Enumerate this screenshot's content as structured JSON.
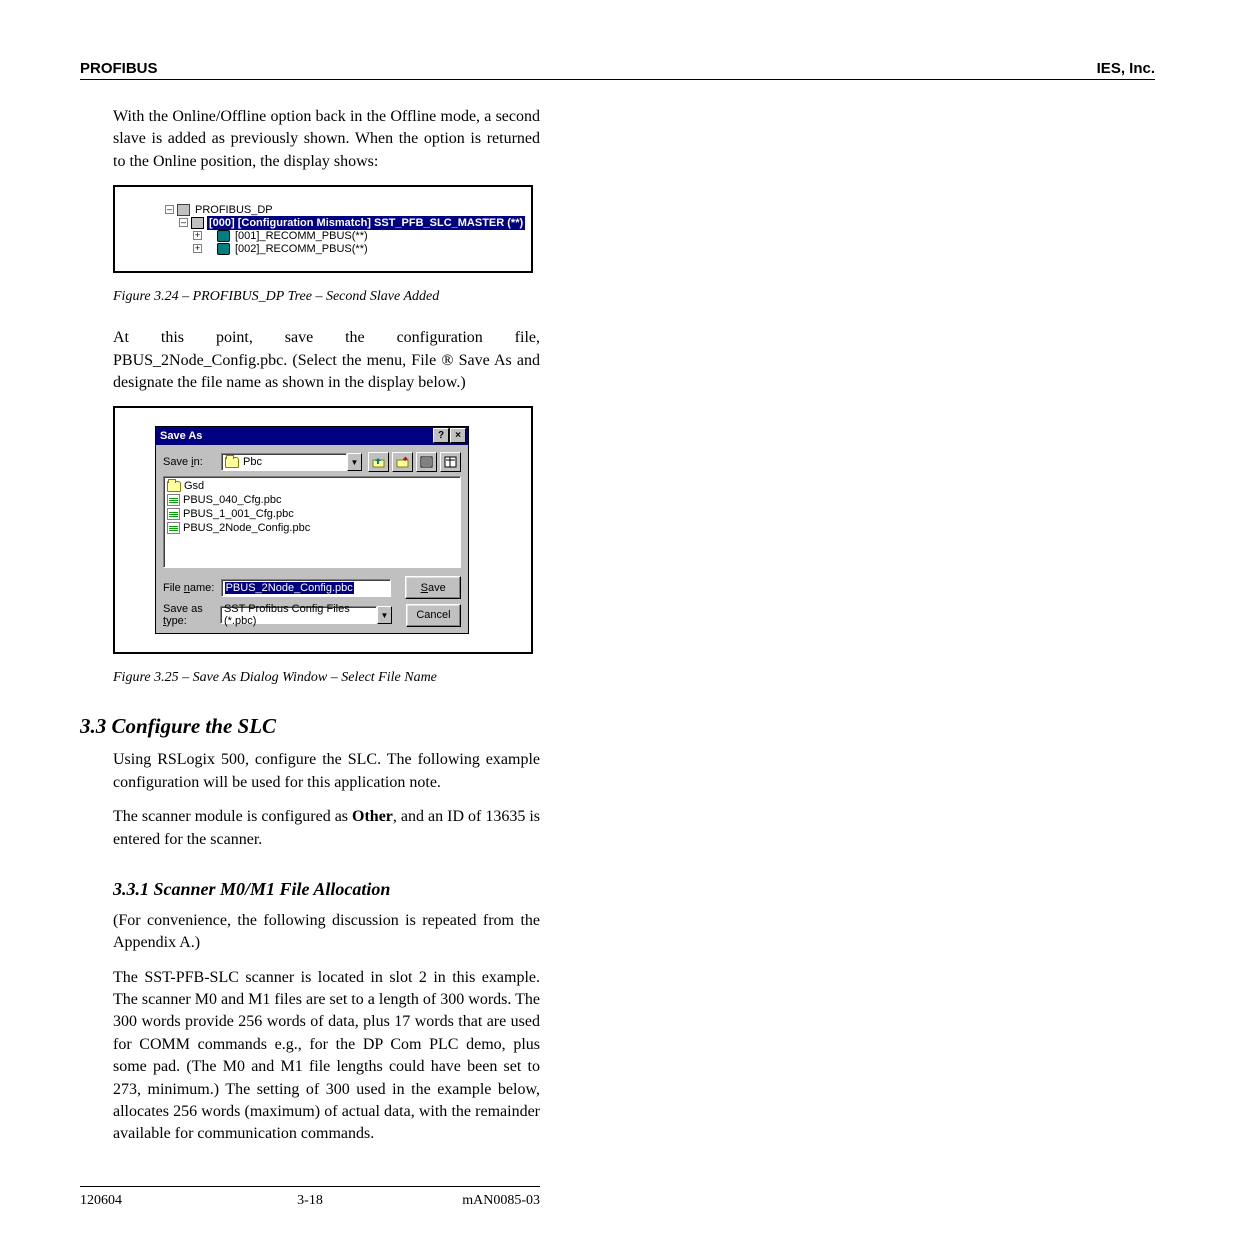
{
  "header": {
    "doc_left": "PROFIBUS",
    "doc_right": "IES, Inc."
  },
  "para1": "With the Online/Offline option back in the Offline mode, a second slave is added as previously shown. When the option is returned to the Online position, the display shows:",
  "tree": {
    "root_label": "PROFIBUS_DP",
    "master_label": "[000] [Configuration Mismatch] SST_PFB_SLC_MASTER (**)",
    "slave1_label": "[001]_RECOMM_PBUS(**)",
    "slave2_label": "[002]_RECOMM_PBUS(**)"
  },
  "fig1_caption": "Figure 3.24 – PROFIBUS_DP Tree – Second Slave Added",
  "para2": "At this point, save the configuration file, PBUS_2Node_Config.pbc. (Select the menu, File ® Save As and designate the file name as shown in the display below.)",
  "saveas": {
    "title": "Save As",
    "savein_lbl_pre": "Save ",
    "savein_lbl_ul": "i",
    "savein_lbl_post": "n:",
    "savein_folder": "Pbc",
    "files": {
      "f0": "Gsd",
      "f1": "PBUS_040_Cfg.pbc",
      "f2": "PBUS_1_001_Cfg.pbc",
      "f3": "PBUS_2Node_Config.pbc"
    },
    "filename_lbl_pre1": "File ",
    "filename_lbl_ul": "n",
    "filename_lbl_post": "ame:",
    "filename_value": "PBUS_2Node_Config.pbc",
    "savetype_lbl_pre": "Save as ",
    "savetype_lbl_ul": "t",
    "savetype_lbl_post": "ype:",
    "savetype_value": "SST Profibus Config Files (*.pbc)",
    "save_ul": "S",
    "save_rest": "ave",
    "cancel": "Cancel"
  },
  "fig2_caption": "Figure 3.25 – Save As Dialog Window – Select File Name",
  "heading2": "3.3 Configure the SLC",
  "para3": "Using RSLogix 500, configure the SLC. The following example configuration will be used for this application note.",
  "para4a": "The scanner module is configured as ",
  "para4b": "Other",
  "para4c": ", and an ID of 13635 is entered for the scanner.",
  "heading3": "3.3.1 Scanner M0/M1 File Allocation",
  "para5": "(For convenience, the following discussion is repeated from the Appendix A.)",
  "para6": "The SST-PFB-SLC scanner is located in slot 2 in this example. The scanner M0 and M1 files are set to a length of 300 words. The 300 words provide 256 words of data, plus 17 words that are used for COMM commands e.g., for the DP Com PLC demo, plus some pad. (The M0 and M1 file lengths could have been set to 273, minimum.) The setting of 300 used in the example below, allocates 256 words (maximum) of actual data, with the remainder available for communication commands.",
  "footer": {
    "left": "120604",
    "center": "3-18",
    "right": "mAN0085-03"
  }
}
